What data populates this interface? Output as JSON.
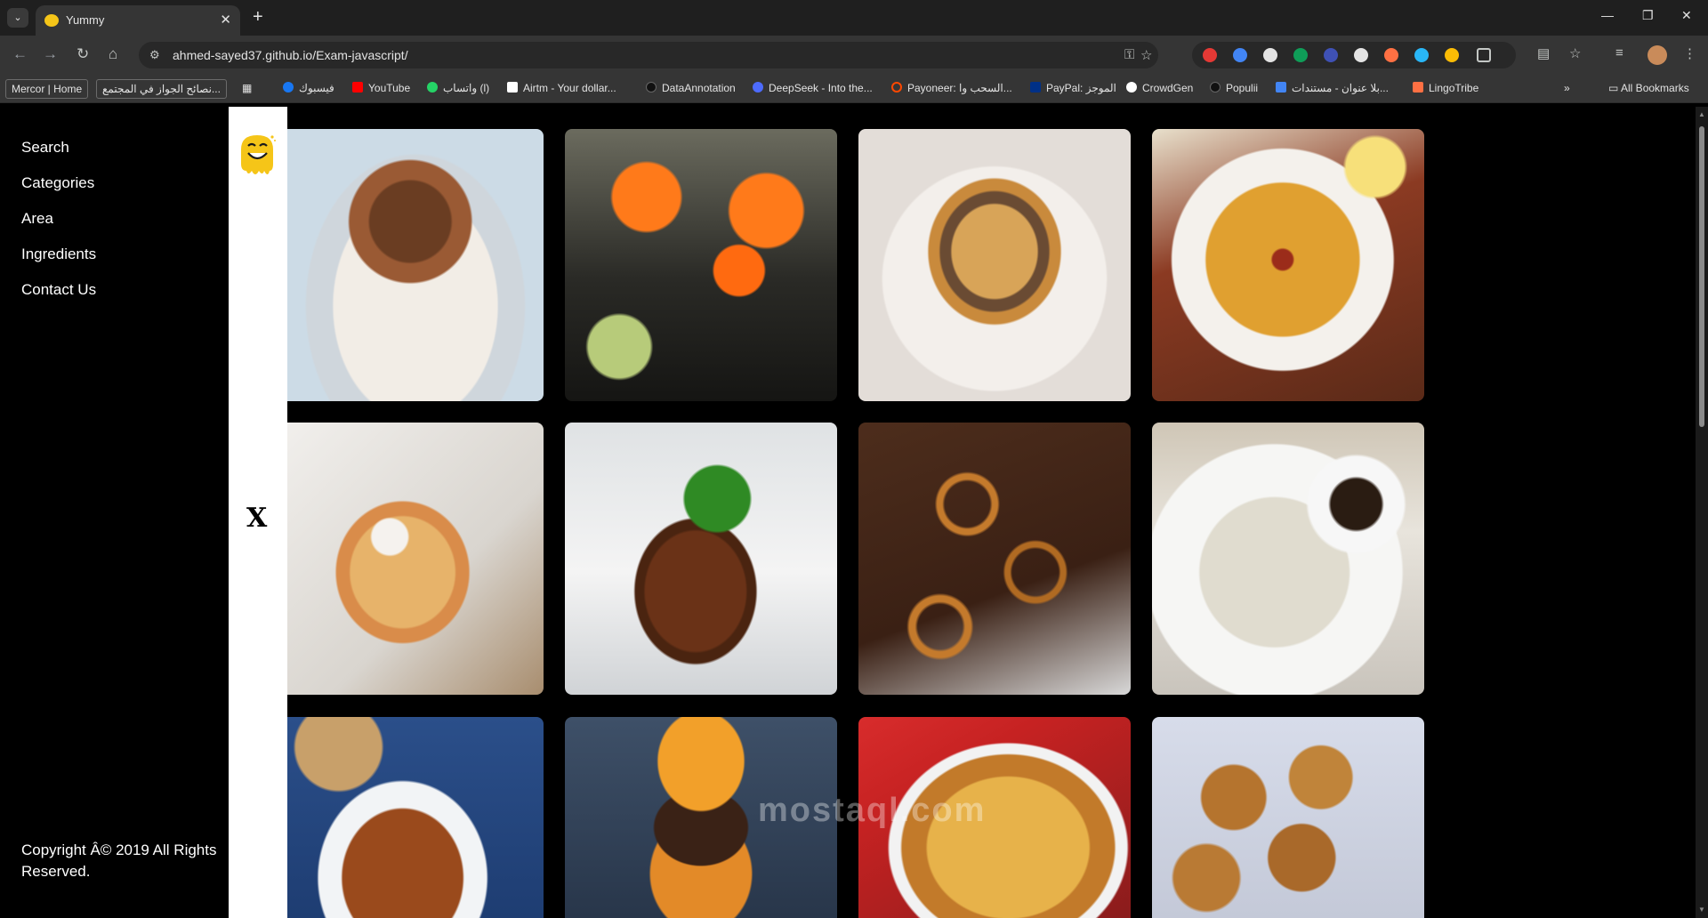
{
  "browser": {
    "tab_title": "Yummy",
    "url": "ahmed-sayed37.github.io/Exam-javascript/",
    "new_tab_symbol": "+",
    "bookmarks": [
      {
        "label": "Mercor | Home",
        "boxed": true
      },
      {
        "label": "نصائح الجواز في المجتمع...",
        "boxed": true
      },
      {
        "label": "فيسبوك",
        "color": "#1877f2"
      },
      {
        "label": "YouTube",
        "color": "#ff0000"
      },
      {
        "label": "واتساب (l)",
        "color": "#25d366"
      },
      {
        "label": "Airtm - Your dollar...",
        "color": "#ffffff"
      },
      {
        "label": "DataAnnotation",
        "color": "#000000"
      },
      {
        "label": "DeepSeek - Into the...",
        "color": "#4d6bfe"
      },
      {
        "label": "Payoneer: السحب وا...",
        "color": "#ff4800"
      },
      {
        "label": "PayPal: الموجز",
        "color": "#003087"
      },
      {
        "label": "CrowdGen",
        "color": "#ffffff"
      },
      {
        "label": "Populii",
        "color": "#000000"
      },
      {
        "label": "بلا عنوان - مستندات...",
        "color": "#4285f4"
      },
      {
        "label": "LingoTribe",
        "color": "#ff7043"
      }
    ],
    "all_bookmarks": "All Bookmarks"
  },
  "sidebar": {
    "links": [
      "Search",
      "Categories",
      "Area",
      "Ingredients",
      "Contact Us"
    ],
    "social_icons": "   ",
    "copyright": "Copyright Â© 2019 All Rights Reserved."
  },
  "strip": {
    "close_symbol": "X",
    "glyph_top": "",
    "glyph_bottom": ""
  },
  "watermark": "mostaql.com",
  "colors": {
    "page_bg": "#000000",
    "strip_bg": "#ffffff",
    "logo_yellow": "#f5c518"
  }
}
